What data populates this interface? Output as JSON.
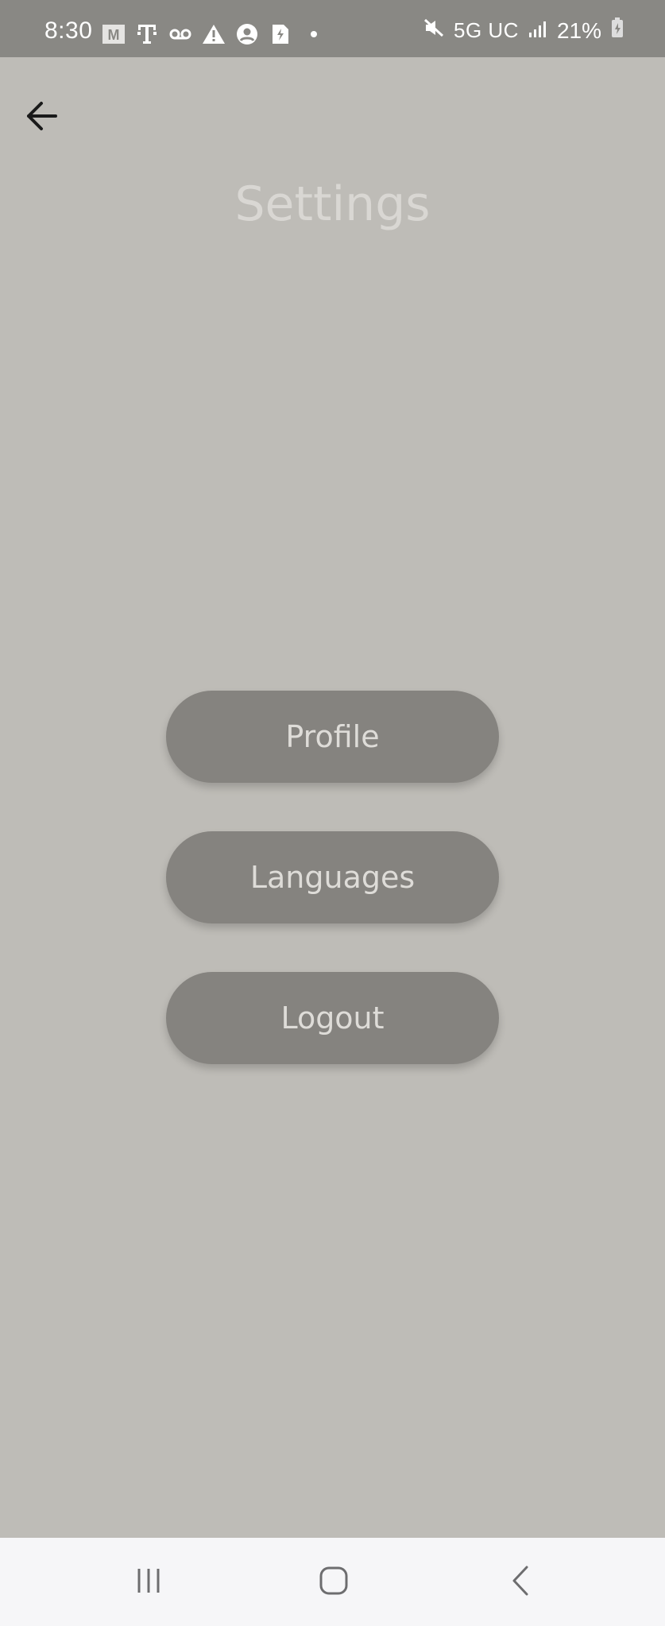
{
  "status_bar": {
    "time": "8:30",
    "network": "5G UC",
    "battery": "21%",
    "icons_left": [
      "gmail-icon",
      "tmobile-icon",
      "voicemail-icon",
      "warning-icon",
      "account-icon",
      "sim-icon",
      "dot-icon"
    ],
    "icons_right": [
      "mute-icon",
      "signal-icon",
      "battery-icon"
    ]
  },
  "header": {
    "back_icon": "arrow-left-icon",
    "title": "Settings"
  },
  "menu": {
    "profile_label": "Profile",
    "languages_label": "Languages",
    "logout_label": "Logout"
  },
  "nav_bar": {
    "icons": [
      "recents-icon",
      "home-icon",
      "back-icon"
    ]
  },
  "colors": {
    "background": "#bebcb7",
    "status_bar": "#898884",
    "button": "#85837f",
    "button_text": "#dedcd8",
    "title": "#d9d7d3",
    "nav_bar": "#f6f6f8"
  }
}
